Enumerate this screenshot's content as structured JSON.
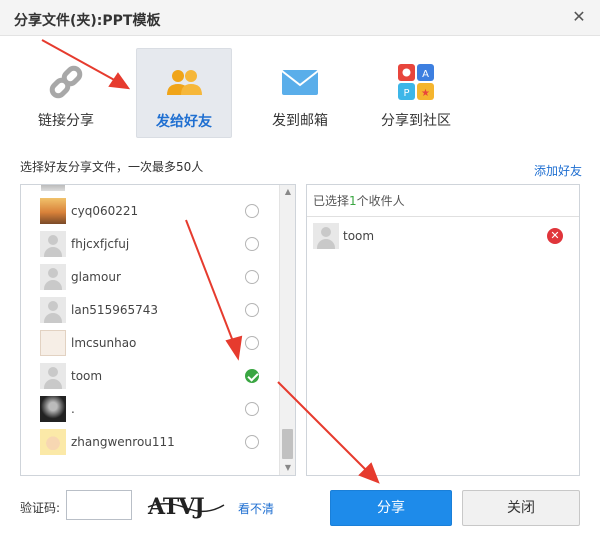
{
  "window": {
    "title": "分享文件(夹):PPT模板"
  },
  "tabs": [
    {
      "label": "链接分享",
      "icon": "link-icon",
      "active": false
    },
    {
      "label": "发给好友",
      "icon": "friends-icon",
      "active": true
    },
    {
      "label": "发到邮箱",
      "icon": "mail-icon",
      "active": false
    },
    {
      "label": "分享到社区",
      "icon": "community-icon",
      "active": false
    }
  ],
  "friends": {
    "hint": "选择好友分享文件，一次最多50人",
    "add_friend_label": "添加好友",
    "list": [
      {
        "name": "cyq060221",
        "checked": false
      },
      {
        "name": "fhjcxfjcfuj",
        "checked": false
      },
      {
        "name": "glamour",
        "checked": false
      },
      {
        "name": "lan515965743",
        "checked": false
      },
      {
        "name": "lmcsunhao",
        "checked": false
      },
      {
        "name": "toom",
        "checked": true
      },
      {
        "name": ".",
        "checked": false
      },
      {
        "name": "zhangwenrou111",
        "checked": false
      }
    ]
  },
  "recipients": {
    "header_prefix": "已选择",
    "count": "1",
    "header_suffix": "个收件人",
    "list": [
      {
        "name": "toom"
      }
    ]
  },
  "footer": {
    "captcha_label": "验证码:",
    "captcha_text": "ATVJ",
    "captcha_refresh_label": "看不清",
    "share_label": "分享",
    "close_label": "关闭"
  },
  "colors": {
    "accent": "#1e8bea",
    "check": "#3aa642",
    "remove": "#e0353b",
    "annotation": "#e63b2e"
  }
}
